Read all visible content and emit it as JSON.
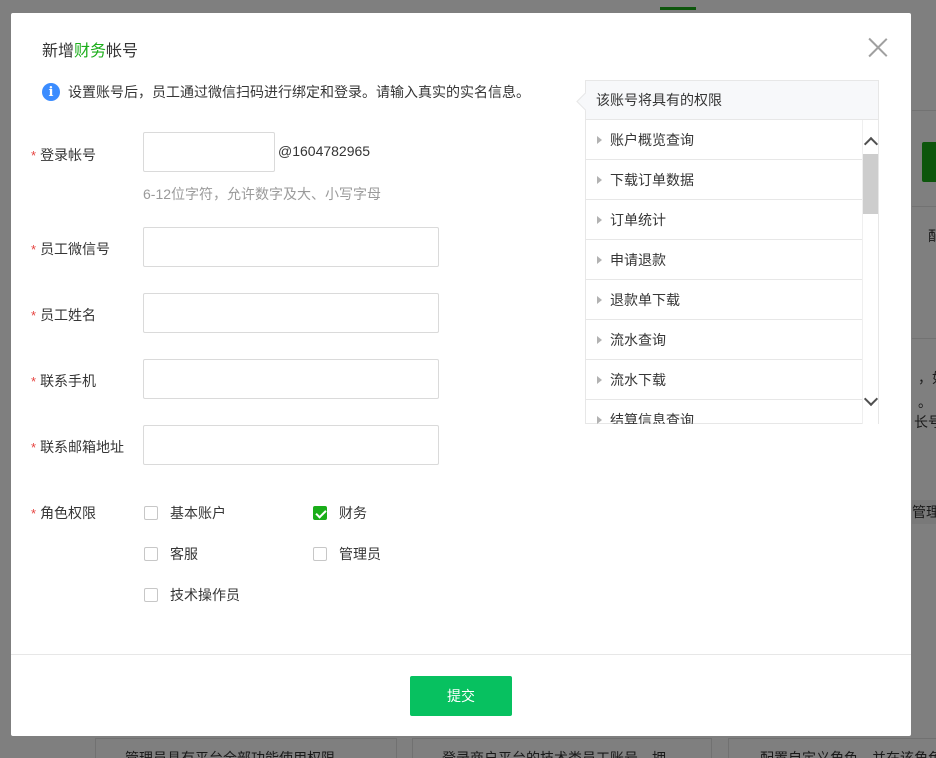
{
  "background": {
    "right_text_1": "配",
    "right_text_2": "，如",
    "right_text_3": "。",
    "right_text_4": "长号。",
    "right_text_5": "管理",
    "bottom_text_1": "管理员具有平台全部功能使用权限",
    "bottom_text_2": "登录商户平台的技术类员工账号，拥",
    "bottom_text_3": "配置自定义角色，并在该角色"
  },
  "dialog": {
    "title_prefix": "新增",
    "title_highlight": "财务",
    "title_suffix": "帐号",
    "notice": "设置账号后，员工通过微信扫码进行绑定和登录。请输入真实的实名信息。",
    "required_mark": "*"
  },
  "form": {
    "login_account": {
      "label": "登录帐号",
      "value": "",
      "suffix": "@1604782965",
      "hint": "6-12位字符，允许数字及大、小写字母"
    },
    "wechat_id": {
      "label": "员工微信号",
      "value": ""
    },
    "name": {
      "label": "员工姓名",
      "value": ""
    },
    "phone": {
      "label": "联系手机",
      "value": ""
    },
    "email": {
      "label": "联系邮箱地址",
      "value": ""
    },
    "roles": {
      "label": "角色权限",
      "options": [
        {
          "label": "基本账户",
          "checked": false
        },
        {
          "label": "财务",
          "checked": true
        },
        {
          "label": "客服",
          "checked": false
        },
        {
          "label": "管理员",
          "checked": false
        },
        {
          "label": "技术操作员",
          "checked": false
        }
      ]
    }
  },
  "permissions": {
    "header": "该账号将具有的权限",
    "items": [
      "账户概览查询",
      "下载订单数据",
      "订单统计",
      "申请退款",
      "退款单下载",
      "流水查询",
      "流水下载",
      "结算信息查询"
    ]
  },
  "footer": {
    "submit_label": "提交"
  },
  "colors": {
    "accent": "#1aad19",
    "submit": "#07c160",
    "required": "#e64340",
    "info": "#3b8cff"
  }
}
